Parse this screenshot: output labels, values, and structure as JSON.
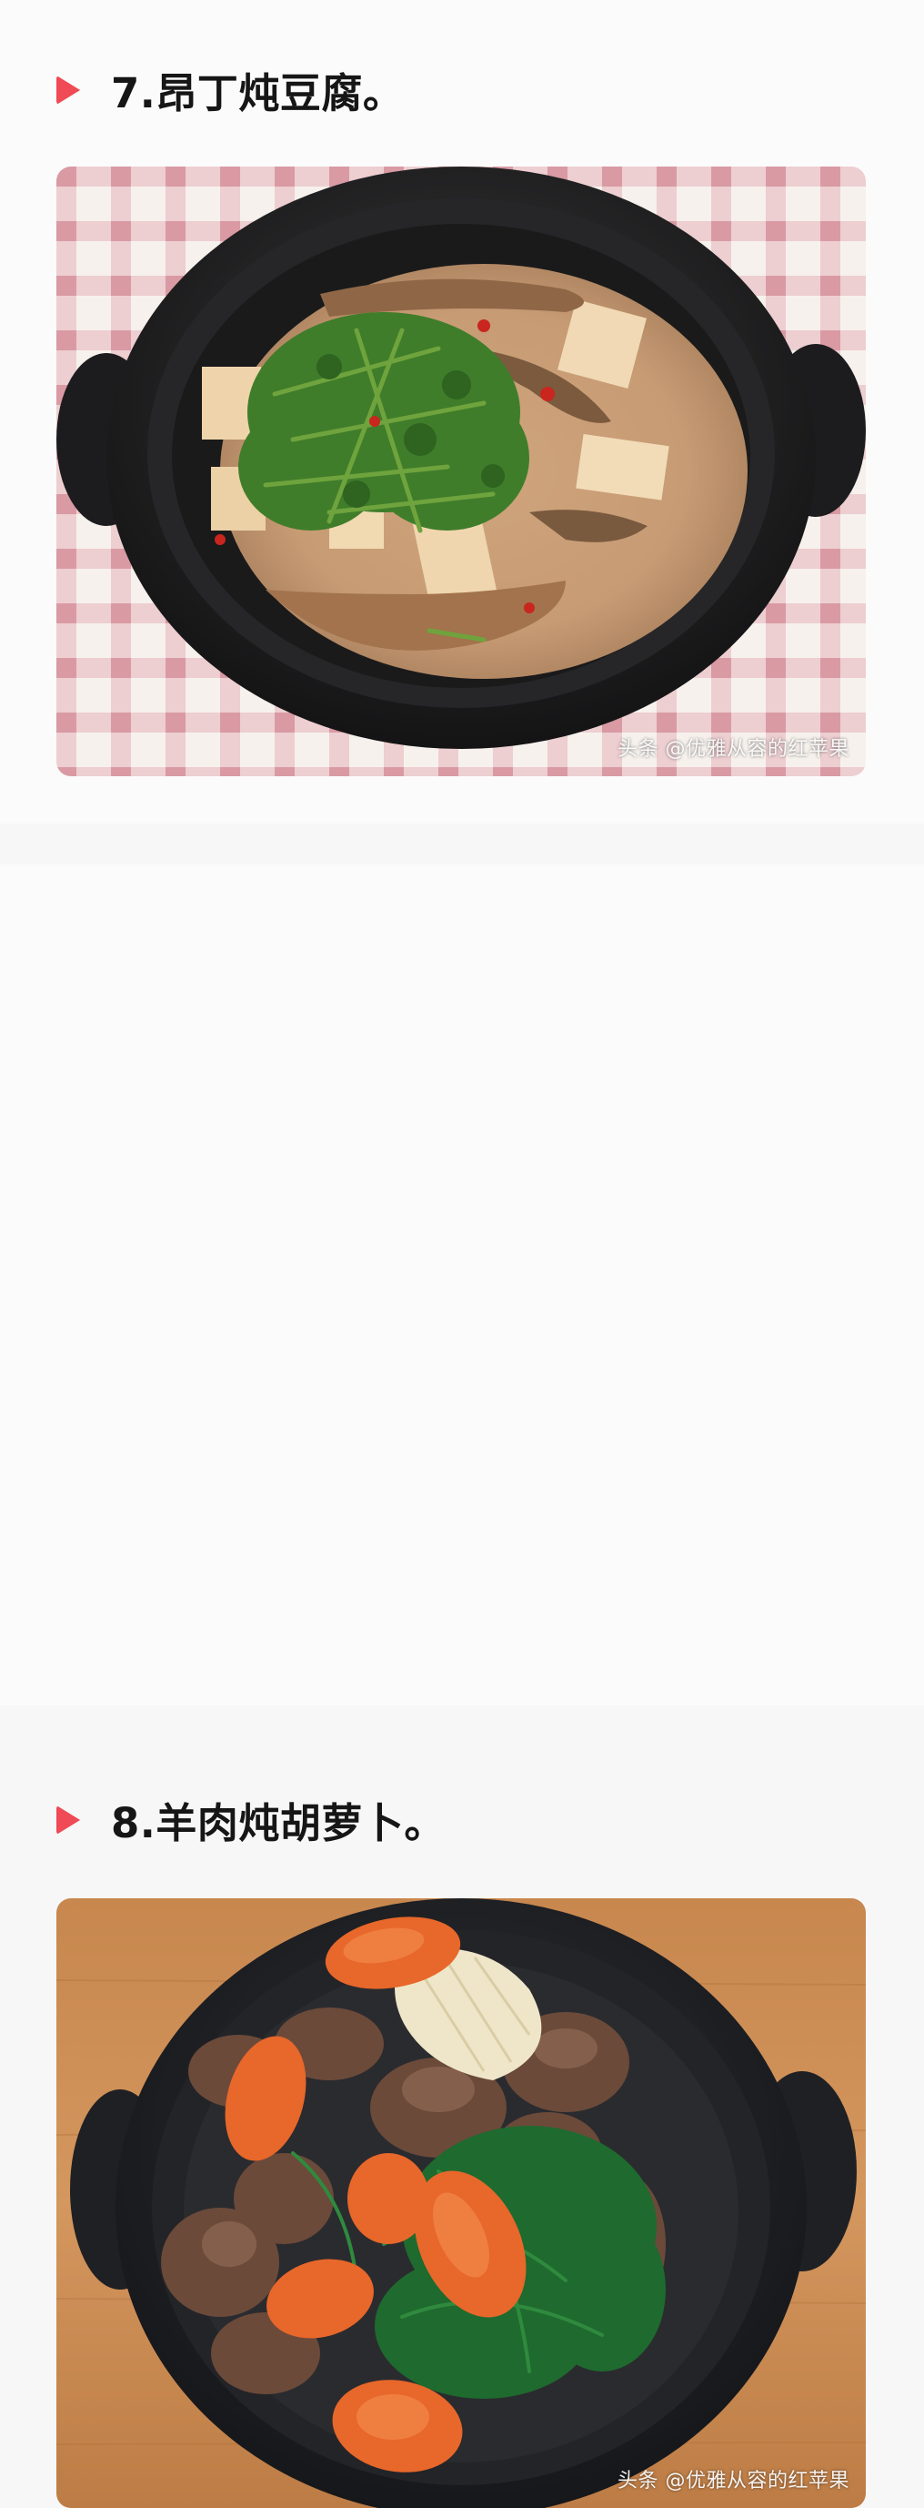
{
  "article": {
    "sections": [
      {
        "title": "7.昂丁炖豆腐。",
        "watermark": "头条 @优雅从容的红苹果",
        "image_subject": "clay-pot-fish-tofu-stew"
      },
      {
        "title": "8.羊肉炖胡萝卜。",
        "watermark": "头条 @优雅从容的红苹果",
        "image_subject": "clay-pot-lamb-carrot-stew"
      }
    ],
    "accent_color": "#ef4a55",
    "heading_icon": "play-triangle-icon"
  }
}
